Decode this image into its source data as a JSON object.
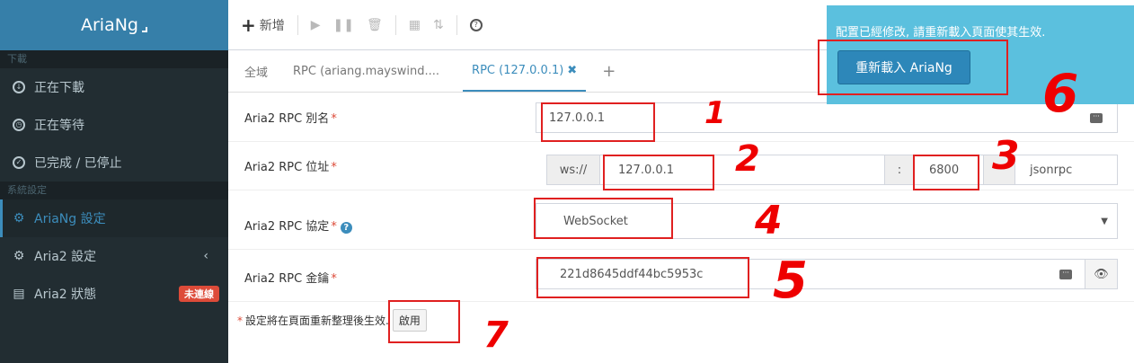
{
  "sidebar": {
    "brand": "AriaNg",
    "sections": [
      {
        "title": "下載"
      },
      {
        "title": "系統設定"
      }
    ],
    "download_items": [
      {
        "label": "正在下載",
        "icon": "download-circle-icon"
      },
      {
        "label": "正在等待",
        "icon": "clock-icon"
      },
      {
        "label": "已完成 / 已停止",
        "icon": "check-circle-icon"
      }
    ],
    "settings_items": [
      {
        "label": "AriaNg 設定",
        "icon": "gear-icon"
      },
      {
        "label": "Aria2 設定",
        "icon": "gears-icon"
      },
      {
        "label": "Aria2 狀態",
        "icon": "server-icon",
        "badge": "未連線"
      }
    ]
  },
  "toolbar": {
    "new_label": "新增"
  },
  "tabs": [
    {
      "label": "全域"
    },
    {
      "label": "RPC (ariang.mayswind...."
    },
    {
      "label": "RPC (127.0.0.1)"
    }
  ],
  "form": {
    "alias": {
      "label": "Aria2 RPC 別名",
      "value": "127.0.0.1"
    },
    "address": {
      "label": "Aria2 RPC 位址",
      "protocol": "ws://",
      "host": "127.0.0.1",
      "colon": ":",
      "port": "6800",
      "path": "jsonrpc"
    },
    "protocol": {
      "label": "Aria2 RPC 協定",
      "value": "WebSocket"
    },
    "secret": {
      "label": "Aria2 RPC 金鑰",
      "value": "221d8645ddf44bc5953c"
    },
    "required_mark": "*"
  },
  "hint": {
    "text": "設定將在頁面重新整理後生效.",
    "button": "啟用"
  },
  "notification": {
    "message": "配置已經修改, 請重新載入頁面使其生效.",
    "button": "重新載入 AriaNg"
  },
  "annotations": [
    "1",
    "2",
    "3",
    "4",
    "5",
    "6",
    "7"
  ],
  "colors": {
    "accent": "#3c8dbc",
    "sidebar": "#222d32",
    "notify": "#5bc0de",
    "annotation": "#e02020"
  }
}
